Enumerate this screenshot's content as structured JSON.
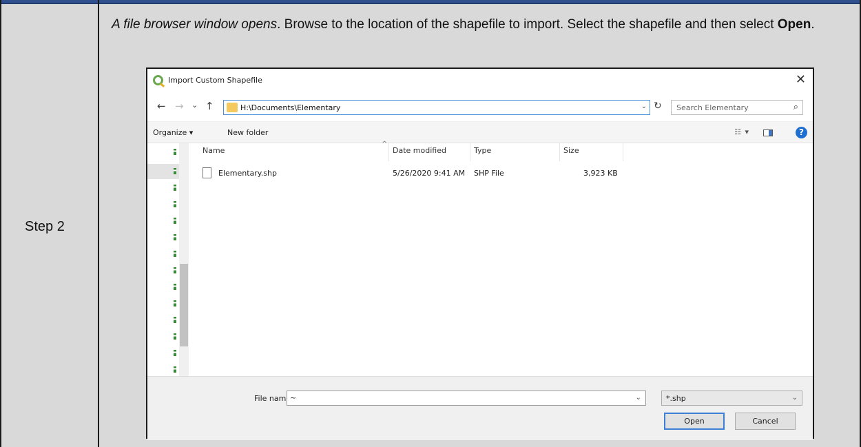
{
  "table": {
    "step_label": "Step 2",
    "instruction_italic": "A file browser window opens",
    "instruction_text": ". Browse to the location of the shapefile to import. Select the shapefile and then select ",
    "instruction_bold": "Open",
    "instruction_end": "."
  },
  "dialog": {
    "title": "Import Custom Shapefile",
    "close": "✕",
    "nav": {
      "back": "←",
      "forward": "→",
      "recent": "⌄",
      "up": "↑"
    },
    "address": "H:\\Documents\\Elementary",
    "search_placeholder": "Search Elementary",
    "toolbar": {
      "organize": "Organize ▾",
      "new_folder": "New folder",
      "help": "?"
    },
    "columns": {
      "name": "Name",
      "date": "Date modified",
      "type": "Type",
      "size": "Size"
    },
    "files": [
      {
        "name": "Elementary.shp",
        "date": "5/26/2020 9:41 AM",
        "type": "SHP File",
        "size": "3,923 KB"
      }
    ],
    "file_name_label": "File name:",
    "file_name_value": "~",
    "filter": "*.shp",
    "open_button": "Open",
    "cancel_button": "Cancel"
  }
}
